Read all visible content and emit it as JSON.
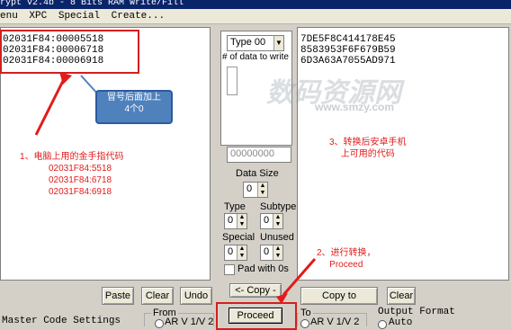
{
  "window": {
    "title": "rypt v2.4b - 8 Bits RAM Write/Fill"
  },
  "menu": {
    "items": [
      "enu",
      "XPC",
      "Special",
      "Create..."
    ]
  },
  "left_codes": [
    "02031F84:00005518",
    "02031F84:00006718",
    "02031F84:00006918"
  ],
  "right_codes": [
    "7DE5F8C414178E45",
    "8583953F6F679B59",
    "6D3A63A7055AD971"
  ],
  "callout": {
    "line1": "冒号后面加上",
    "line2": "4个0"
  },
  "annot_pc": {
    "title": "1、电脑上用的金手指代码",
    "codes": [
      "02031F84:5518",
      "02031F84:6718",
      "02031F84:6918"
    ]
  },
  "annot_android": {
    "line1": "3、转换后安卓手机",
    "line2": "上可用的代码"
  },
  "annot_proceed": {
    "line1": "2、进行转换，",
    "line2": "Proceed"
  },
  "middle": {
    "type_select": "Type 00",
    "data_count_label": "# of data to write",
    "hex_field": "00000000",
    "data_size_label": "Data Size",
    "data_size_value": "0",
    "type_label": "Type",
    "type_value": "0",
    "subtype_label": "Subtype",
    "subtype_value": "0",
    "special_label": "Special",
    "special_value": "0",
    "unused_label": "Unused",
    "unused_value": "0",
    "pad_label": "Pad with 0s"
  },
  "buttons": {
    "paste": "Paste",
    "clear_left": "Clear",
    "undo": "Undo",
    "copy": "<- Copy -",
    "copy_clipboard": "Copy to Clipboard",
    "clear_right": "Clear",
    "proceed": "Proceed"
  },
  "bottom": {
    "master_code": "Master Code Settings",
    "from_label": "From",
    "from_value": "AR V 1/V 2",
    "to_label": "To",
    "to_value": "AR V 1/V 2",
    "output_format": "Output Format",
    "auto_label": "Auto"
  },
  "watermark": {
    "main": "数码资源网",
    "sub": "www.smzy.com"
  },
  "colors": {
    "annotation": "#e31b1b",
    "callout_bg": "#4f81bd",
    "titlebar": "#0a246a"
  }
}
